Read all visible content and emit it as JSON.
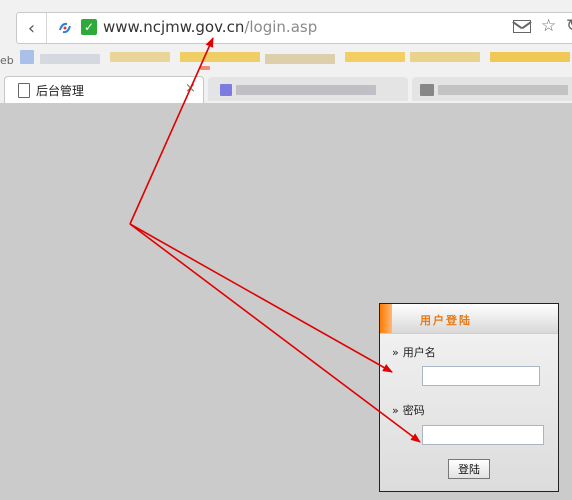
{
  "browser": {
    "url_host": "www.ncjmw.gov.cn",
    "url_path": "/login.asp",
    "bookmark_label": "eb",
    "active_tab_title": "后台管理",
    "tab_close_glyph": "×",
    "back_glyph": "‹",
    "secure_glyph": "✓",
    "star_glyph": "☆",
    "reload_glyph": "↻"
  },
  "login": {
    "title": "用户登陆",
    "username_label": "用户名",
    "password_label": "密码",
    "field_marker": "»",
    "username_value": "",
    "password_value": "",
    "submit_label": "登陆"
  },
  "annotation": {
    "arrow_color": "#e00000"
  },
  "colors": {
    "page_background": "#cbcbcb",
    "login_title": "#e87a18",
    "secure_green": "#2eaa3a"
  }
}
